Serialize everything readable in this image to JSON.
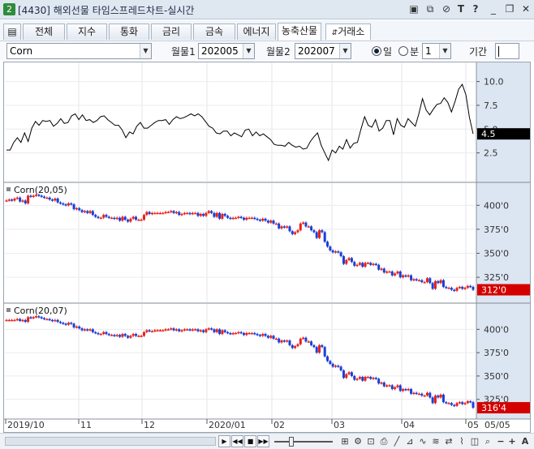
{
  "window": {
    "badge": "2",
    "title": "[4430] 해외선물 타임스프레드차트-실시간"
  },
  "titlebar_icons": [
    "layout-icon",
    "copy-icon",
    "link-icon",
    "font-icon",
    "help-icon",
    "minimize-icon",
    "restore-icon",
    "close-icon"
  ],
  "tabs": [
    {
      "label": "전체"
    },
    {
      "label": "지수"
    },
    {
      "label": "통화"
    },
    {
      "label": "금리"
    },
    {
      "label": "금속"
    },
    {
      "label": "에너지"
    },
    {
      "label": "농축산물"
    }
  ],
  "exchange_button": "거래소",
  "toolbar": {
    "product": "Corn",
    "month1_label": "월물1",
    "month1_value": "202005",
    "month2_label": "월물2",
    "month2_value": "202007",
    "radio_day": "일",
    "radio_min": "분",
    "min_value": "1",
    "period_label": "기간",
    "period_value": ""
  },
  "colors": {
    "up": "#e8211b",
    "down": "#1b3fd6",
    "line": "#000000",
    "axis_bg": "#dce6f2",
    "value_tag": "#d40000"
  },
  "chart_data": [
    {
      "type": "line",
      "name": "spread",
      "yticks": [
        "10.0",
        "7.5",
        "5.0",
        "2.5"
      ],
      "ylim": [
        0,
        11.5
      ],
      "last_value": "4.5",
      "values": [
        2.8,
        2.8,
        3.6,
        4.1,
        3.6,
        4.6,
        3.7,
        5.1,
        5.8,
        5.4,
        5.9,
        5.8,
        5.9,
        5.3,
        5.6,
        6.1,
        5.6,
        5.7,
        6.4,
        6.6,
        6.0,
        6.5,
        5.9,
        6.0,
        5.7,
        5.9,
        6.3,
        6.4,
        6.0,
        5.7,
        5.4,
        5.4,
        4.9,
        4.1,
        4.7,
        4.5,
        5.3,
        5.7,
        5.1,
        5.1,
        5.4,
        5.7,
        5.9,
        5.9,
        6.0,
        5.5,
        6.0,
        6.3,
        6.1,
        6.2,
        6.4,
        6.6,
        6.4,
        6.6,
        6.3,
        5.8,
        5.3,
        5.1,
        4.6,
        4.5,
        4.8,
        4.8,
        4.3,
        4.6,
        4.4,
        4.2,
        4.9,
        5.0,
        4.3,
        4.7,
        4.3,
        4.5,
        4.2,
        3.9,
        3.4,
        3.3,
        3.3,
        3.2,
        3.6,
        3.3,
        3.1,
        3.2,
        2.9,
        3.0,
        3.7,
        4.2,
        4.6,
        3.3,
        2.5,
        1.7,
        2.8,
        2.5,
        3.2,
        2.9,
        3.9,
        3.0,
        3.5,
        3.6,
        5.0,
        6.3,
        5.4,
        5.2,
        6.0,
        4.8,
        5.1,
        5.9,
        5.9,
        4.4,
        6.1,
        5.4,
        5.2,
        6.1,
        5.7,
        5.3,
        6.6,
        8.2,
        7.0,
        6.5,
        7.1,
        7.6,
        7.7,
        8.3,
        7.8,
        6.8,
        7.9,
        9.2,
        9.7,
        8.6,
        6.2,
        4.5
      ]
    },
    {
      "type": "candlestick",
      "name": "Corn(20,05)",
      "yticks": [
        "400'0",
        "375'0",
        "350'0",
        "325'0"
      ],
      "ylim": [
        304,
        418
      ],
      "last_value": "312'0",
      "closes": [
        405,
        406,
        405,
        407,
        408,
        404,
        405,
        402,
        410,
        409,
        410,
        411,
        410,
        409,
        408,
        408,
        406,
        405,
        407,
        403,
        402,
        401,
        400,
        402,
        401,
        396,
        397,
        395,
        393,
        394,
        392,
        394,
        390,
        388,
        387,
        387,
        390,
        388,
        387,
        387,
        386,
        387,
        384,
        388,
        385,
        383,
        386,
        388,
        385,
        385,
        385,
        390,
        393,
        391,
        392,
        392,
        392,
        392,
        392,
        393,
        393,
        394,
        392,
        393,
        390,
        391,
        392,
        392,
        391,
        392,
        392,
        389,
        391,
        389,
        392,
        394,
        392,
        388,
        392,
        386,
        391,
        389,
        387,
        386,
        387,
        387,
        388,
        387,
        385,
        387,
        387,
        387,
        386,
        385,
        384,
        386,
        384,
        382,
        384,
        381,
        381,
        376,
        378,
        377,
        378,
        373,
        370,
        372,
        374,
        381,
        382,
        378,
        378,
        374,
        372,
        366,
        374,
        372,
        362,
        357,
        353,
        351,
        352,
        351,
        347,
        339,
        343,
        345,
        341,
        337,
        338,
        340,
        336,
        340,
        340,
        338,
        339,
        338,
        333,
        334,
        330,
        331,
        331,
        327,
        329,
        331,
        325,
        327,
        326,
        327,
        322,
        323,
        322,
        322,
        320,
        320,
        324,
        319,
        313,
        321,
        319,
        322,
        315,
        314,
        314,
        312,
        311,
        314,
        315,
        313,
        314,
        316,
        315,
        312
      ]
    },
    {
      "type": "candlestick",
      "name": "Corn(20,07)",
      "yticks": [
        "400'0",
        "375'0",
        "350'0",
        "325'0"
      ],
      "ylim": [
        310,
        422
      ],
      "last_value": "316'4",
      "closes": [
        410,
        410,
        410,
        410,
        411,
        409,
        410,
        408,
        413,
        412,
        413,
        414,
        413,
        412,
        411,
        411,
        410,
        409,
        410,
        408,
        407,
        406,
        405,
        407,
        406,
        402,
        403,
        401,
        399,
        400,
        399,
        400,
        397,
        396,
        395,
        395,
        397,
        395,
        394,
        394,
        393,
        394,
        392,
        395,
        393,
        391,
        393,
        395,
        393,
        393,
        393,
        397,
        399,
        398,
        398,
        399,
        399,
        399,
        399,
        400,
        400,
        401,
        399,
        400,
        398,
        399,
        400,
        400,
        399,
        400,
        400,
        398,
        399,
        397,
        400,
        401,
        400,
        397,
        400,
        395,
        399,
        397,
        396,
        395,
        396,
        396,
        397,
        396,
        394,
        396,
        396,
        396,
        395,
        394,
        393,
        395,
        393,
        391,
        393,
        390,
        390,
        386,
        388,
        387,
        388,
        383,
        380,
        382,
        384,
        390,
        391,
        387,
        387,
        383,
        381,
        375,
        383,
        381,
        371,
        366,
        363,
        360,
        361,
        360,
        356,
        348,
        352,
        354,
        350,
        346,
        347,
        349,
        345,
        349,
        349,
        347,
        348,
        347,
        342,
        343,
        339,
        340,
        340,
        336,
        338,
        340,
        334,
        336,
        335,
        336,
        331,
        332,
        331,
        331,
        329,
        329,
        332,
        327,
        321,
        329,
        327,
        330,
        322,
        321,
        321,
        319,
        318,
        321,
        322,
        320,
        321,
        323,
        322,
        316
      ]
    }
  ],
  "x_axis_labels": [
    "2019/10",
    "11",
    "12",
    "2020/01",
    "02",
    "03",
    "04",
    "05",
    "05/05"
  ],
  "scroll_icons": [
    "scroll-right-icon",
    "rewind-icon",
    "pause-icon",
    "stop-icon"
  ],
  "zoom_tools": [
    "settings-icon",
    "zoom-out-icon",
    "zoom-in-icon",
    "text-icon"
  ]
}
